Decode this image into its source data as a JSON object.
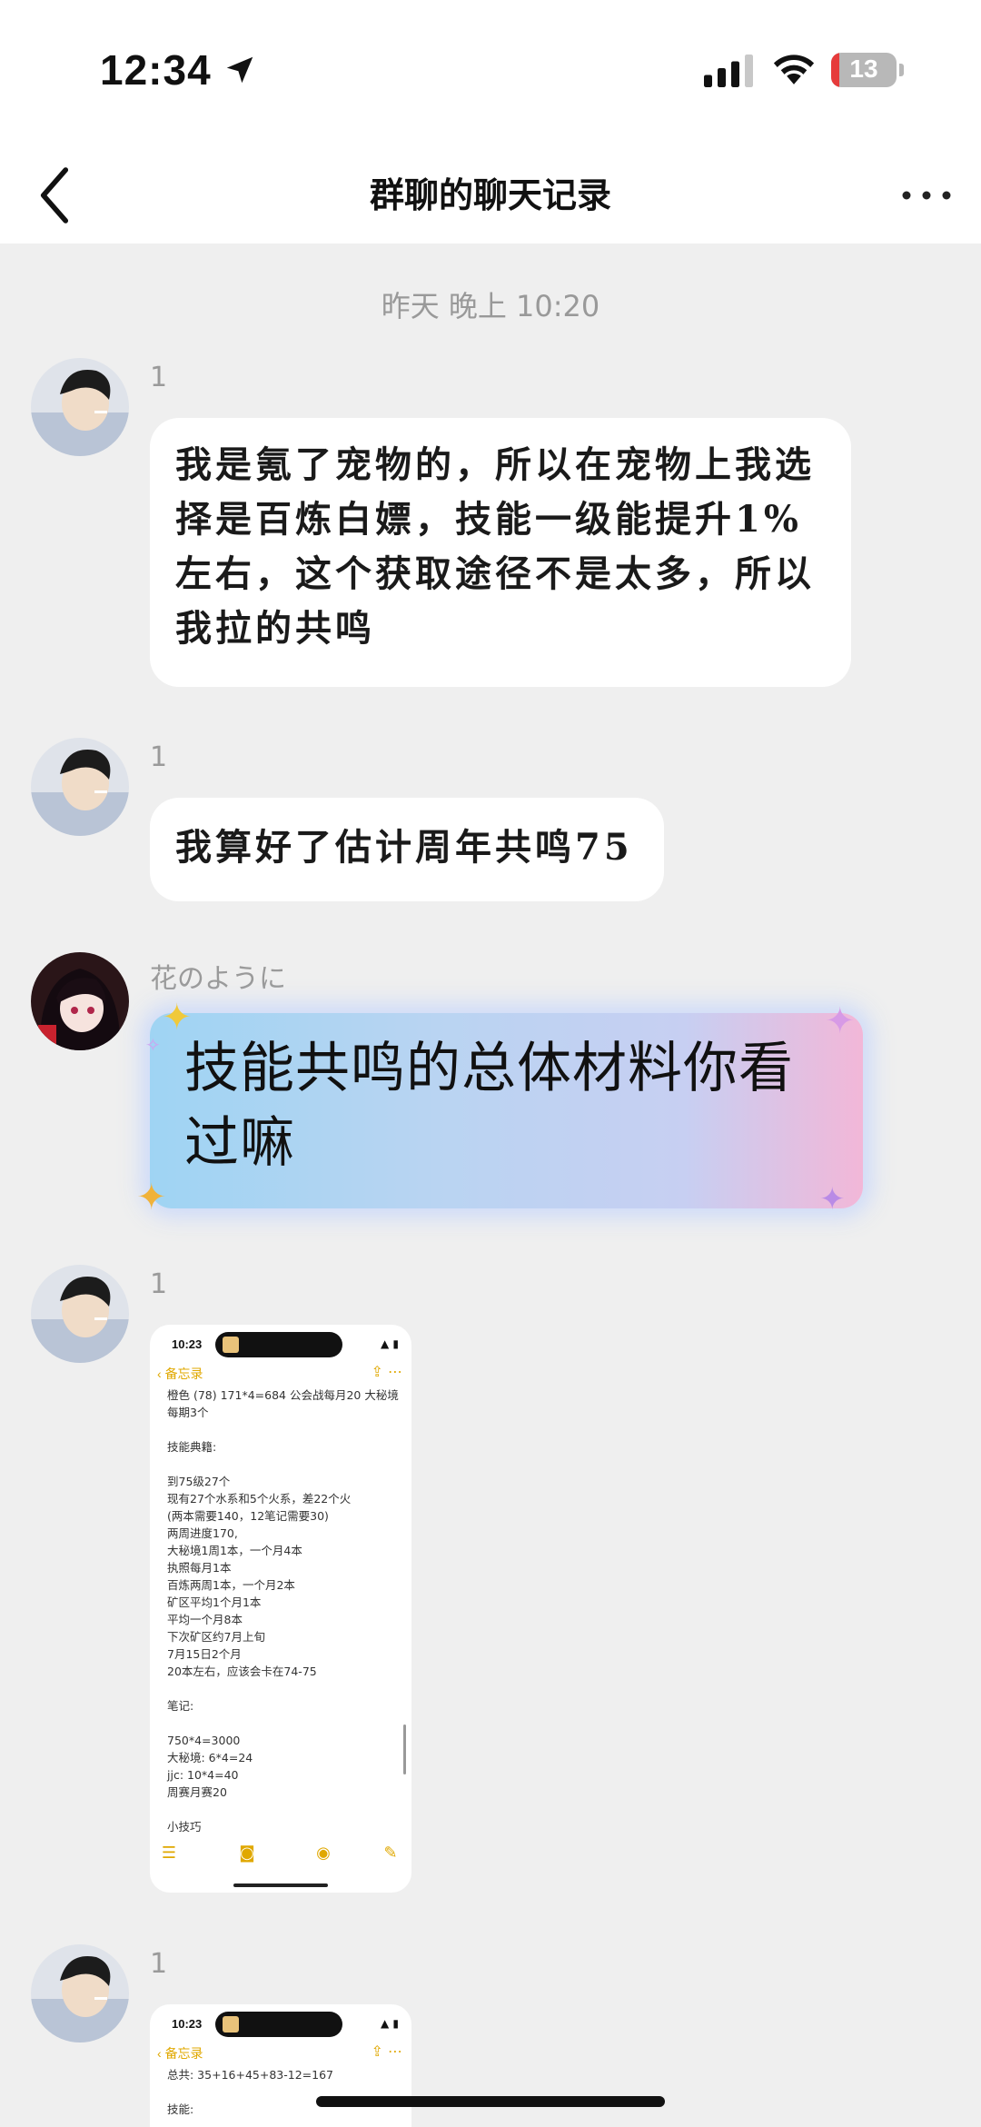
{
  "status_bar": {
    "time": "12:34",
    "battery": "13",
    "battery_level": 0.13,
    "battery_color": "#e63b3b"
  },
  "nav": {
    "title": "群聊的聊天记录"
  },
  "timestamp": "昨天 晚上 10:20",
  "messages": [
    {
      "sender": "1",
      "text": "我是氪了宠物的，所以在宠物上我选择是百炼白嫖，技能一级能提升1%左右，这个获取途径不是太多，所以我拉的共鸣"
    },
    {
      "sender": "1",
      "text": "我算好了估计周年共鸣75"
    },
    {
      "sender": "花のように",
      "text": "技能共鸣的总体材料你看过嘛"
    },
    {
      "sender": "1",
      "image": {
        "time": "10:23",
        "nav_label": "备忘录",
        "lines": [
          "橙色 (78) 171*4=684 公会战每月20 大秘境",
          "每期3个",
          "",
          "技能典籍:",
          "",
          "到75级27个",
          "现有27个水系和5个火系，差22个火",
          "(两本需要140，12笔记需要30)",
          "两周进度170,",
          "大秘境1周1本，一个月4本",
          "执照每月1本",
          "百炼两周1本，一个月2本",
          "矿区平均1个月1本",
          "平均一个月8本",
          "下次矿区约7月上旬",
          "7月15日2个月",
          "20本左右，应该会卡在74-75",
          "",
          "笔记:",
          "",
          "750*4=3000",
          "大秘境: 6*4=24",
          "jjc: 10*4=40",
          "周赛月赛20",
          "",
          "小技巧"
        ]
      }
    },
    {
      "sender": "1",
      "image": {
        "time": "10:23",
        "nav_label": "备忘录",
        "lines": [
          "总共: 35+16+45+83-12=167",
          "",
          "技能:"
        ]
      }
    }
  ]
}
